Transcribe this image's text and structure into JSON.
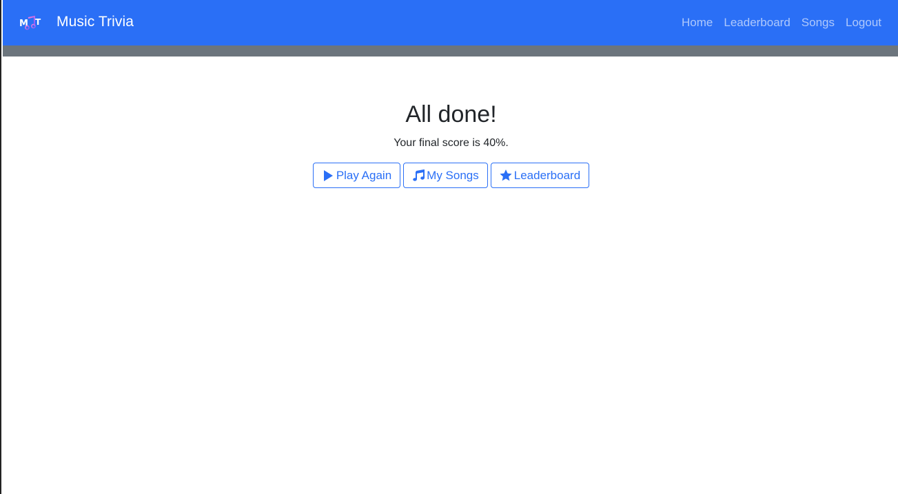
{
  "navbar": {
    "logo_text": "MT",
    "brand_name": "Music Trivia",
    "links": [
      {
        "label": "Home"
      },
      {
        "label": "Leaderboard"
      },
      {
        "label": "Songs"
      },
      {
        "label": "Logout"
      }
    ]
  },
  "main": {
    "title": "All done!",
    "score_text": "Your final score is 40%.",
    "buttons": [
      {
        "label": "Play Again",
        "icon": "play-icon"
      },
      {
        "label": "My Songs",
        "icon": "music-note-icon"
      },
      {
        "label": "Leaderboard",
        "icon": "star-icon"
      }
    ]
  },
  "colors": {
    "navbar_bg": "#2a6ff6",
    "subbar_bg": "#6c757d",
    "accent": "#2a6ff6",
    "text": "#212529"
  }
}
